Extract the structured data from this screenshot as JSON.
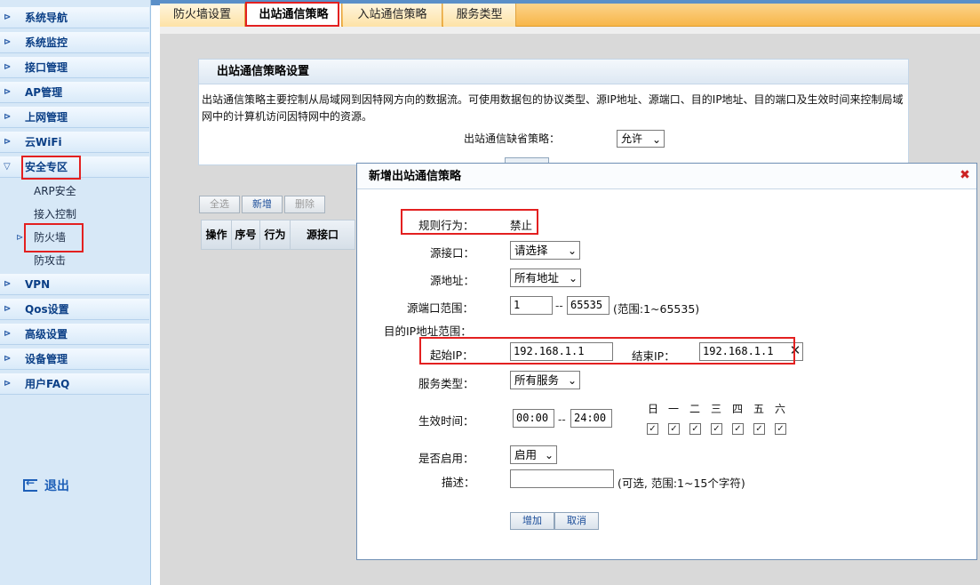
{
  "sidebar": {
    "items": [
      {
        "label": "系统导航"
      },
      {
        "label": "系统监控"
      },
      {
        "label": "接口管理"
      },
      {
        "label": "AP管理"
      },
      {
        "label": "上网管理"
      },
      {
        "label": "云WiFi"
      },
      {
        "label": "安全专区"
      },
      {
        "label": "VPN"
      },
      {
        "label": "Qos设置"
      },
      {
        "label": "高级设置"
      },
      {
        "label": "设备管理"
      },
      {
        "label": "用户FAQ"
      }
    ],
    "sub_items": [
      {
        "label": "ARP安全"
      },
      {
        "label": "接入控制"
      },
      {
        "label": "防火墙"
      },
      {
        "label": "防攻击"
      }
    ],
    "logout": "退出"
  },
  "tabs": [
    {
      "label": "防火墙设置"
    },
    {
      "label": "出站通信策略"
    },
    {
      "label": "入站通信策略"
    },
    {
      "label": "服务类型"
    }
  ],
  "panel": {
    "title": "出站通信策略设置",
    "description": "出站通信策略主要控制从局域网到因特网方向的数据流。可使用数据包的协议类型、源IP地址、源端口、目的IP地址、目的端口及生效时间来控制局域网中的计算机访问因特网中的资源。",
    "default_policy_label": "出站通信缺省策略：",
    "default_policy_value": "允许"
  },
  "toolbar": {
    "select_all": "全选",
    "add": "新增",
    "delete": "删除"
  },
  "table": {
    "headers": [
      "操作",
      "序号",
      "行为",
      "源接口"
    ]
  },
  "modal": {
    "title": "新增出站通信策略",
    "rule_action_label": "规则行为：",
    "rule_action_value": "禁止",
    "src_interface_label": "源接口：",
    "src_interface_value": "请选择",
    "src_address_label": "源地址：",
    "src_address_value": "所有地址",
    "src_port_label": "源端口范围：",
    "src_port_start": "1",
    "src_port_end": "65535",
    "src_port_hint": "(范围:1~65535)",
    "dst_ip_range_label": "目的IP地址范围：",
    "start_ip_label": "起始IP：",
    "start_ip_value": "192.168.1.1",
    "end_ip_label": "结束IP：",
    "end_ip_value": "192.168.1.1",
    "service_type_label": "服务类型：",
    "service_type_value": "所有服务",
    "effective_time_label": "生效时间：",
    "time_start": "00:00",
    "time_end": "24:00",
    "days": [
      "日",
      "一",
      "二",
      "三",
      "四",
      "五",
      "六"
    ],
    "days_checked": [
      true,
      true,
      true,
      true,
      true,
      true,
      true
    ],
    "enabled_label": "是否启用：",
    "enabled_value": "启用",
    "desc_label": "描述：",
    "desc_value": "",
    "desc_hint": "(可选, 范围:1~15个字符)",
    "add_button": "增加",
    "cancel_button": "取消",
    "dash": "--"
  },
  "colors": {
    "accent_tab": "#f7b649",
    "highlight_red": "#e32020",
    "sidebar_text": "#0b3f86"
  }
}
